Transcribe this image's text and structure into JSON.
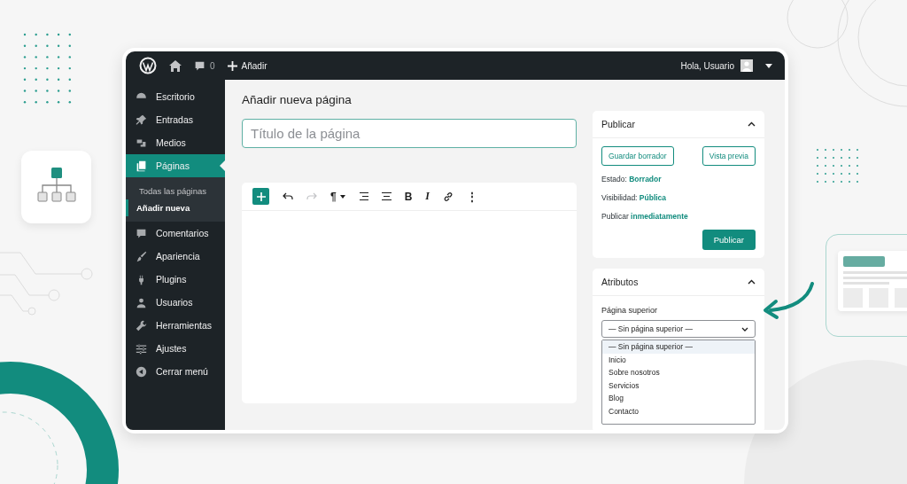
{
  "topbar": {
    "comments_count": "0",
    "add_label": "Añadir",
    "greeting": "Hola, Usuario"
  },
  "sidebar": {
    "items": [
      {
        "label": "Escritorio",
        "selected": false
      },
      {
        "label": "Entradas",
        "selected": false
      },
      {
        "label": "Medios",
        "selected": false
      },
      {
        "label": "Páginas",
        "selected": true,
        "children": [
          {
            "label": "Todas las páginas",
            "selected": false
          },
          {
            "label": "Añadir nueva",
            "selected": true
          }
        ]
      },
      {
        "label": "Comentarios",
        "selected": false
      },
      {
        "label": "Apariencia",
        "selected": false
      },
      {
        "label": "Plugins",
        "selected": false
      },
      {
        "label": "Usuarios",
        "selected": false
      },
      {
        "label": "Herramientas",
        "selected": false
      },
      {
        "label": "Ajustes",
        "selected": false
      },
      {
        "label": "Cerrar menú",
        "selected": false
      }
    ]
  },
  "page_title": "Añadir nueva página",
  "title_field": {
    "placeholder": "Título de la página"
  },
  "editor_toolbar": [
    {
      "kind": "add"
    },
    {
      "kind": "undo",
      "disabled": false
    },
    {
      "kind": "redo",
      "disabled": true
    },
    {
      "kind": "glyph",
      "label": "¶",
      "dropdown": true
    },
    {
      "kind": "align-right"
    },
    {
      "kind": "align-center"
    },
    {
      "kind": "glyph",
      "label": "B"
    },
    {
      "kind": "glyph",
      "label": "I",
      "italic": true
    },
    {
      "kind": "link"
    },
    {
      "kind": "glyph",
      "label": "⋮"
    }
  ],
  "publish_box": {
    "title": "Publicar",
    "expanded": true,
    "save_draft": "Guardar borrador",
    "preview": "Vista previa",
    "rows": [
      {
        "label": "Estado:",
        "value": "Borrador"
      },
      {
        "label": "Visibilidad:",
        "value": "Pública"
      },
      {
        "label": "Publicar",
        "value": "inmediatamente"
      }
    ],
    "publish_button": "Publicar"
  },
  "attributes_box": {
    "title": "Atributos",
    "expanded": true,
    "field_label": "Página superior",
    "select_value": "— Sin página superior —",
    "options": [
      {
        "label": "— Sin página superior —",
        "selected": true
      },
      {
        "label": "Inicio",
        "selected": false
      },
      {
        "label": "Sobre nosotros",
        "selected": false
      },
      {
        "label": "Servicios",
        "selected": false
      },
      {
        "label": "Blog",
        "selected": false
      },
      {
        "label": "Contacto",
        "selected": false
      }
    ]
  }
}
